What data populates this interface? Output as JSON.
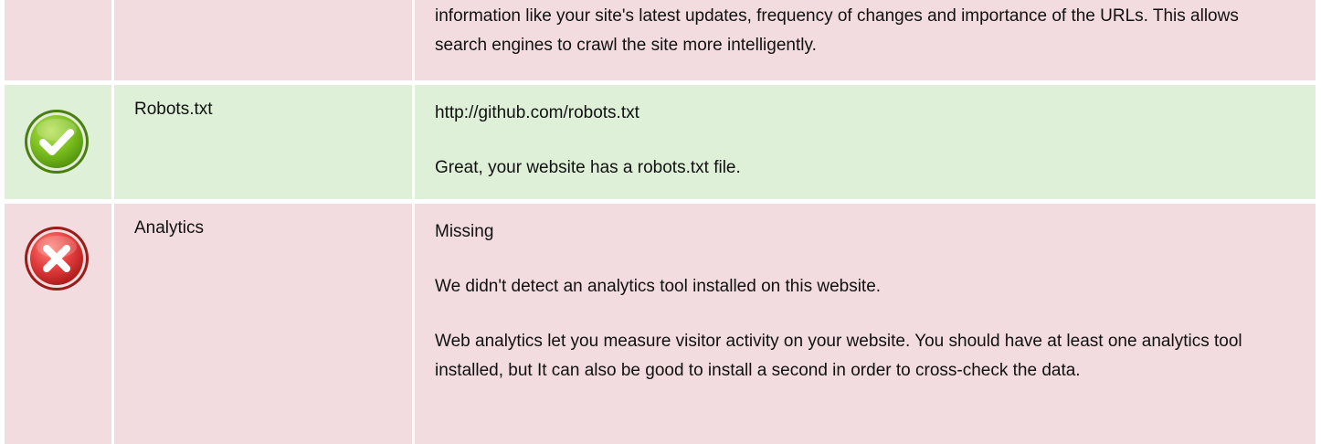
{
  "colors": {
    "bad_row_bg": "#f2dcdf",
    "good_row_bg": "#dff0d8",
    "success_icon": "#7cbf1f",
    "error_icon": "#e23b3b"
  },
  "rows": [
    {
      "status": "bad",
      "icon": "",
      "label": "",
      "lines": [
        "information like your site's latest updates, frequency of changes and importance of the URLs. This allows search engines to crawl the site more intelligently."
      ]
    },
    {
      "status": "good",
      "icon": "check-circle-icon",
      "label": "Robots.txt",
      "lines": [
        "http://github.com/robots.txt",
        "Great, your website has a robots.txt file."
      ]
    },
    {
      "status": "bad",
      "icon": "x-circle-icon",
      "label": "Analytics",
      "lines": [
        "Missing",
        "We didn't detect an analytics tool installed on this website.",
        "Web analytics let you measure visitor activity on your website. You should have at least one analytics tool installed, but It can also be good to install a second in order to cross-check the data."
      ]
    }
  ]
}
